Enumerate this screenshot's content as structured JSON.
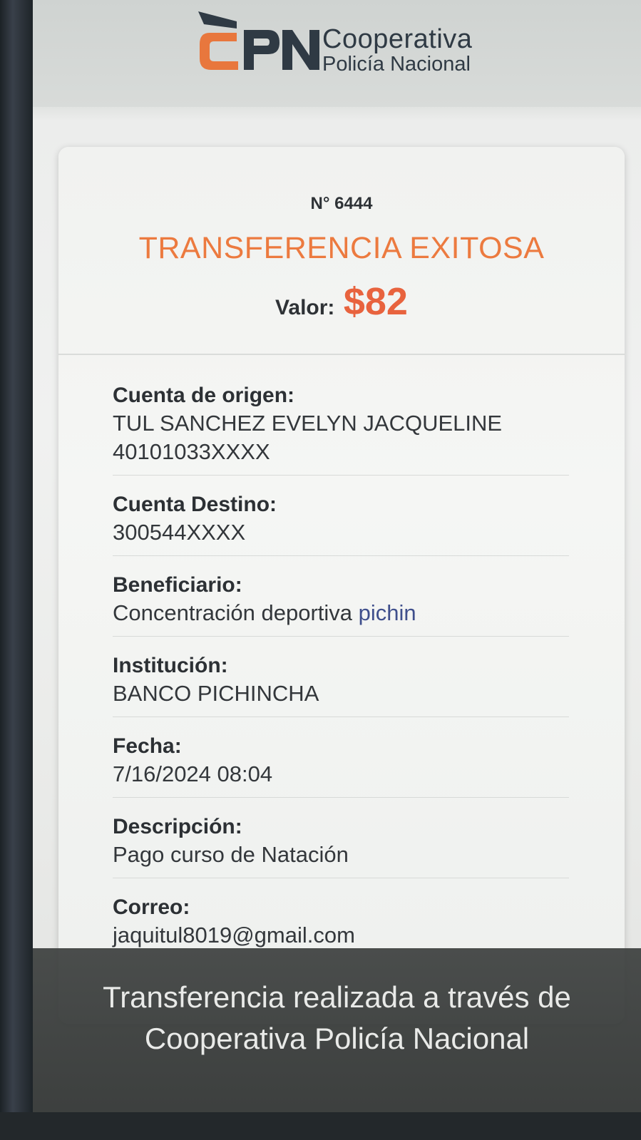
{
  "brand": {
    "line1": "Cooperativa",
    "line2": "Policía Nacional",
    "logo_letters": "CPN"
  },
  "receipt": {
    "number": "N° 6444",
    "status_title": "TRANSFERENCIA EXITOSA",
    "amount_label": "Valor:",
    "amount_value": "$82"
  },
  "fields": [
    {
      "label": "Cuenta de origen:",
      "value": "TUL SANCHEZ EVELYN JACQUELINE",
      "value2": "40101033XXXX"
    },
    {
      "label": "Cuenta Destino:",
      "value": "300544XXXX"
    },
    {
      "label": "Beneficiario:",
      "value": "Concentración deportiva",
      "value_link": "pichin"
    },
    {
      "label": "Institución:",
      "value": "BANCO PICHINCHA"
    },
    {
      "label": "Fecha:",
      "value": "7/16/2024 08:04"
    },
    {
      "label": "Descripción:",
      "value": "Pago curso de Natación"
    },
    {
      "label": "Correo:",
      "value": "jaquitul8019@gmail.com"
    }
  ],
  "banner": {
    "line1": "Transferencia realizada a través de",
    "line2": "Cooperativa Policía Nacional"
  },
  "colors": {
    "accent_orange": "#ec7a3f",
    "amount_red": "#e8633e",
    "text_dark": "#2c3034"
  }
}
